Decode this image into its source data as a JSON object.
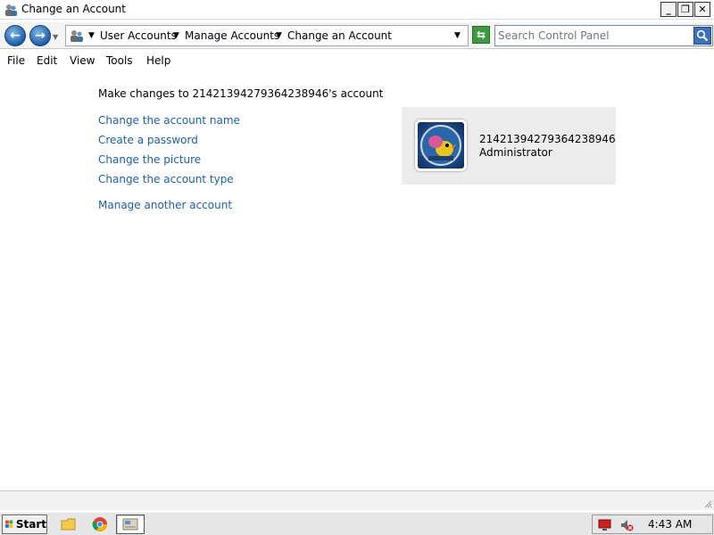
{
  "window": {
    "title": "Change an Account",
    "minimize_label": "_",
    "maximize_label": "❐",
    "close_label": "✕"
  },
  "address": {
    "back_label": "←",
    "forward_label": "→",
    "breadcrumbs": [
      "User Accounts",
      "Manage Accounts",
      "Change an Account"
    ],
    "search_placeholder": "Search Control Panel",
    "refresh_label": "⇆"
  },
  "menu": {
    "items": [
      "File",
      "Edit",
      "View",
      "Tools",
      "Help"
    ]
  },
  "content": {
    "heading": "Make changes to 21421394279364238946's account",
    "tasks": [
      "Change the account name",
      "Create a password",
      "Change the picture",
      "Change the account type"
    ],
    "other_task": "Manage another account",
    "account": {
      "name": "21421394279364238946",
      "type": "Administrator"
    }
  },
  "taskbar": {
    "start_label": "Start",
    "clock": "4:43 AM"
  },
  "colors": {
    "link": "#1c5fa8",
    "card_bg": "#ececec"
  },
  "icons": {
    "title": "users-icon",
    "breadcrumb_root": "users-icon",
    "search": "magnifier-icon",
    "avatar": "windows-7-birds-picture",
    "tray": [
      "network-icon",
      "volume-muted-icon"
    ],
    "quick_launch": [
      "folder-icon",
      "chrome-icon"
    ]
  }
}
